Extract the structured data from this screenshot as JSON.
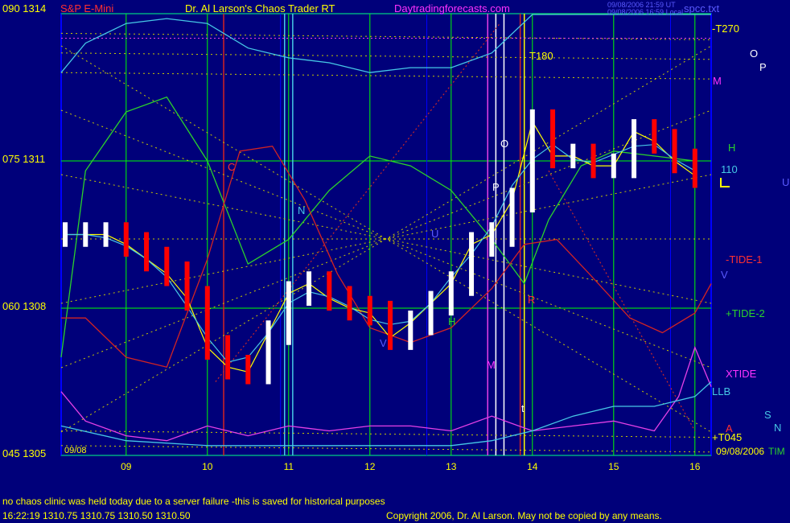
{
  "header": {
    "price_top_left": "090  1314",
    "symbol": "S&P E-Mini",
    "program": "Dr. Al Larson's Chaos Trader RT",
    "website": "Daytradingforecasts.com",
    "timestamp_1": "09/08/2006 21:59 UT",
    "timestamp_2": "09/08/2006 16:59 Local",
    "file": "spcc.txt"
  },
  "left_scale": [
    {
      "label": "090  1314",
      "price": 1314
    },
    {
      "label": "075  1311",
      "price": 1311
    },
    {
      "label": "060  1308",
      "price": 1308
    },
    {
      "label": "045  1305",
      "price": 1305
    }
  ],
  "bottom_labels": {
    "start_date": "09/08",
    "end_date": "09/08/2006",
    "end_suffix": "TIM"
  },
  "right_labels": {
    "t270": "-T270",
    "o": "O",
    "p": "P",
    "m": "M",
    "h": "H",
    "ef110": "110",
    "u": "U",
    "tide1": "-TIDE-1",
    "v": "V",
    "tide2": "+TIDE-2",
    "xtide": "XTIDE",
    "llb": "LLB",
    "s": "S",
    "n": "N",
    "a": "A",
    "t045": "+T045"
  },
  "in_chart_labels": {
    "t180": "T180",
    "o_mid": "O",
    "c": "C",
    "n": "N",
    "u": "U",
    "p": "P",
    "r": "R",
    "v": "V",
    "h": "H",
    "m": "M",
    "t": "t"
  },
  "footer": {
    "note": "no chaos clinic was held today due to a server failure -this is saved for historical purposes",
    "quote_line": "16:22:19  1310.75  1310.75  1310.50  1310.50",
    "copyright": "Copyright 2006, Dr. Al Larson. May not be copied by any means."
  },
  "colors": {
    "background": "#00007a",
    "grid_green": "#00ff00",
    "grid_blue": "#0000ff",
    "bar_up": "#ffffff",
    "bar_down": "#ff0000",
    "cyan_line": "#46c8e6",
    "green_line": "#2bd22b",
    "red_line": "#d22323",
    "magenta_line": "#e640e6",
    "yellow_line": "#ffff00",
    "dotted_yellow": "#c8c800",
    "dotted_red": "#c82828",
    "header_red": "#ff3030",
    "header_yellow": "#ffff00",
    "header_magenta": "#ff32ff",
    "header_blue": "#5a5aff"
  },
  "chart_data": {
    "type": "line",
    "title": "S&P E-Mini",
    "x_axis": {
      "ticks": [
        "09",
        "10",
        "11",
        "12",
        "13",
        "14",
        "15",
        "16"
      ],
      "start_hour": 8.2,
      "end_hour": 16.2
    },
    "y_axis": {
      "min": 1305,
      "max": 1314
    },
    "price_bars": {
      "hours": [
        8.25,
        8.5,
        8.75,
        9.0,
        9.25,
        9.5,
        9.75,
        10.0,
        10.25,
        10.5,
        10.75,
        11.0,
        11.25,
        11.5,
        11.75,
        12.0,
        12.25,
        12.5,
        12.75,
        13.0,
        13.25,
        13.5,
        13.75,
        14.0,
        14.25,
        14.5,
        14.75,
        15.0,
        15.25,
        15.5,
        15.75,
        16.0
      ],
      "close": [
        1309.5,
        1309.5,
        1309.5,
        1309.3,
        1309.0,
        1308.7,
        1308.2,
        1307.2,
        1306.8,
        1306.7,
        1307.5,
        1308.3,
        1308.5,
        1308.2,
        1308.0,
        1307.9,
        1307.4,
        1307.7,
        1308.1,
        1308.5,
        1309.3,
        1309.5,
        1310.2,
        1311.8,
        1311.1,
        1311.1,
        1310.9,
        1310.9,
        1311.6,
        1311.4,
        1311.0,
        1310.7
      ]
    },
    "curves": [
      {
        "name": "cyan",
        "hours": [
          8.2,
          8.5,
          9.0,
          9.5,
          10.0,
          10.5,
          11.0,
          11.5,
          12.0,
          12.5,
          13.0,
          13.5,
          14.0,
          14.5,
          15.0,
          15.5,
          16.0,
          16.2
        ],
        "values": [
          1312.8,
          1313.4,
          1313.8,
          1313.9,
          1313.8,
          1313.3,
          1313.1,
          1313.0,
          1312.8,
          1312.9,
          1312.9,
          1313.2,
          1314.8,
          1315.8,
          1316.2,
          1316.0,
          1315.7,
          1315.6
        ]
      },
      {
        "name": "green",
        "hours": [
          8.2,
          8.5,
          9.0,
          9.5,
          10.0,
          10.5,
          11.0,
          11.5,
          12.0,
          12.5,
          13.0,
          13.5,
          13.9,
          14.2,
          14.6,
          15.0,
          15.5,
          16.0
        ],
        "values": [
          1307.0,
          1310.8,
          1312.0,
          1312.3,
          1311.0,
          1308.9,
          1309.4,
          1310.4,
          1311.1,
          1310.9,
          1310.4,
          1309.4,
          1308.5,
          1309.8,
          1310.9,
          1311.2,
          1311.1,
          1311.0
        ]
      },
      {
        "name": "red",
        "hours": [
          8.2,
          8.5,
          9.0,
          9.5,
          10.0,
          10.4,
          10.8,
          11.2,
          11.6,
          12.0,
          12.5,
          13.0,
          13.5,
          13.9,
          14.3,
          14.7,
          15.2,
          15.6,
          16.0,
          16.2
        ],
        "values": [
          1307.8,
          1307.8,
          1307.0,
          1306.8,
          1309.0,
          1311.2,
          1311.3,
          1310.2,
          1308.7,
          1307.6,
          1307.3,
          1307.6,
          1308.4,
          1309.3,
          1309.4,
          1308.7,
          1307.8,
          1307.5,
          1307.9,
          1308.5
        ]
      },
      {
        "name": "magenta",
        "hours": [
          8.2,
          8.5,
          9.0,
          9.5,
          10.0,
          10.5,
          11.0,
          11.5,
          12.0,
          12.5,
          13.0,
          13.5,
          14.0,
          14.5,
          15.0,
          15.5,
          15.8,
          16.0,
          16.2
        ],
        "values": [
          1306.3,
          1305.7,
          1305.4,
          1305.3,
          1305.6,
          1305.4,
          1305.6,
          1305.5,
          1305.6,
          1305.6,
          1305.5,
          1305.8,
          1305.5,
          1305.6,
          1305.7,
          1305.5,
          1306.2,
          1307.2,
          1306.4
        ]
      },
      {
        "name": "lower-cyan",
        "hours": [
          8.2,
          9.0,
          10.0,
          11.0,
          12.0,
          13.0,
          13.5,
          14.0,
          14.5,
          15.0,
          15.5,
          16.0,
          16.2
        ],
        "values": [
          1305.6,
          1305.3,
          1305.2,
          1305.2,
          1305.2,
          1305.2,
          1305.3,
          1305.5,
          1305.8,
          1306.0,
          1306.0,
          1306.2,
          1306.5
        ]
      }
    ]
  }
}
